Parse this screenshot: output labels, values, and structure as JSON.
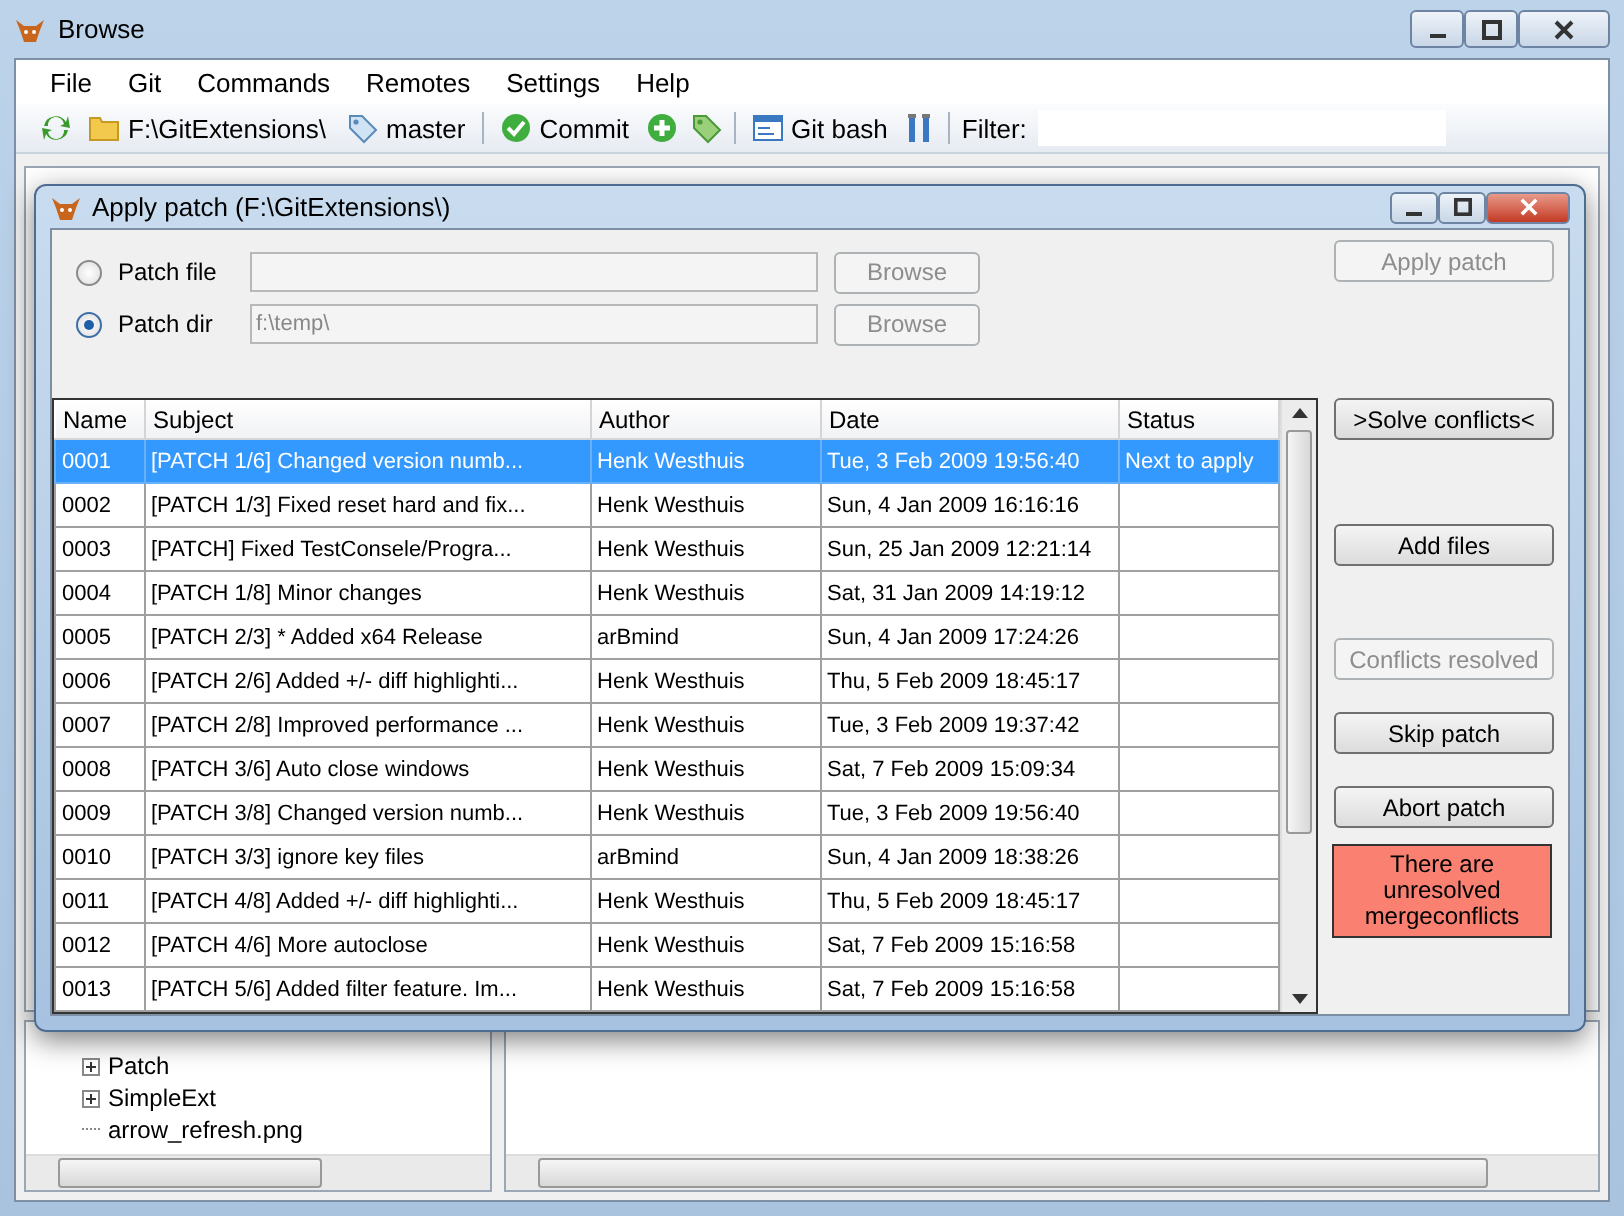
{
  "window": {
    "title": "Browse"
  },
  "menu": [
    "File",
    "Git",
    "Commands",
    "Remotes",
    "Settings",
    "Help"
  ],
  "toolbar": {
    "path": "F:\\GitExtensions\\",
    "branch": "master",
    "commit": "Commit",
    "git_bash": "Git bash",
    "filter_label": "Filter:"
  },
  "tree": {
    "items": [
      {
        "label": "Patch",
        "expandable": true
      },
      {
        "label": "SimpleExt",
        "expandable": true
      },
      {
        "label": "arrow_refresh.png",
        "expandable": false
      }
    ]
  },
  "dialog": {
    "title": "Apply patch (F:\\GitExtensions\\)",
    "sources": [
      {
        "label": "Patch file",
        "selected": false,
        "button": "Browse"
      },
      {
        "label": "Patch dir",
        "selected": true,
        "value": "f:\\temp\\",
        "button": "Browse"
      }
    ],
    "apply_button": {
      "label": "Apply patch",
      "disabled": true
    },
    "table": {
      "columns": [
        "Name",
        "Subject",
        "Author",
        "Date",
        "Status"
      ],
      "rows": [
        {
          "selected": true,
          "cells": [
            "0001",
            "[PATCH 1/6] Changed version numb...",
            "Henk Westhuis",
            "Tue, 3 Feb 2009 19:56:40",
            "Next to apply"
          ]
        },
        {
          "selected": false,
          "cells": [
            "0002",
            "[PATCH 1/3] Fixed reset hard and fix...",
            "Henk Westhuis",
            "Sun, 4 Jan 2009 16:16:16",
            ""
          ]
        },
        {
          "selected": false,
          "cells": [
            "0003",
            "[PATCH] Fixed TestConsele/Progra...",
            "Henk Westhuis",
            "Sun, 25 Jan 2009 12:21:14",
            ""
          ]
        },
        {
          "selected": false,
          "cells": [
            "0004",
            "[PATCH 1/8] Minor changes",
            "Henk Westhuis",
            "Sat, 31 Jan 2009 14:19:12",
            ""
          ]
        },
        {
          "selected": false,
          "cells": [
            "0005",
            "[PATCH 2/3]  * Added x64 Release",
            "arBmind",
            "Sun, 4 Jan 2009 17:24:26",
            ""
          ]
        },
        {
          "selected": false,
          "cells": [
            "0006",
            "[PATCH 2/6] Added +/- diff highlighti...",
            "Henk Westhuis",
            "Thu, 5 Feb 2009 18:45:17",
            ""
          ]
        },
        {
          "selected": false,
          "cells": [
            "0007",
            "[PATCH 2/8] Improved performance ...",
            "Henk Westhuis",
            "Tue, 3 Feb 2009 19:37:42",
            ""
          ]
        },
        {
          "selected": false,
          "cells": [
            "0008",
            "[PATCH 3/6] Auto close windows",
            "Henk Westhuis",
            "Sat, 7 Feb 2009 15:09:34",
            ""
          ]
        },
        {
          "selected": false,
          "cells": [
            "0009",
            "[PATCH 3/8] Changed version numb...",
            "Henk Westhuis",
            "Tue, 3 Feb 2009 19:56:40",
            ""
          ]
        },
        {
          "selected": false,
          "cells": [
            "0010",
            "[PATCH 3/3] ignore key files",
            "arBmind",
            "Sun, 4 Jan 2009 18:38:26",
            ""
          ]
        },
        {
          "selected": false,
          "cells": [
            "0011",
            "[PATCH 4/8] Added +/- diff highlighti...",
            "Henk Westhuis",
            "Thu, 5 Feb 2009 18:45:17",
            ""
          ]
        },
        {
          "selected": false,
          "cells": [
            "0012",
            "[PATCH 4/6] More autoclose",
            "Henk Westhuis",
            "Sat, 7 Feb 2009 15:16:58",
            ""
          ]
        },
        {
          "selected": false,
          "cells": [
            "0013",
            "[PATCH 5/6] Added filter feature. Im...",
            "Henk Westhuis",
            "Sat, 7 Feb 2009 15:16:58",
            ""
          ]
        }
      ]
    },
    "actions": [
      {
        "label": ">Solve conflicts<",
        "disabled": false
      },
      {
        "label": "Add files",
        "disabled": false
      },
      {
        "label": "Conflicts resolved",
        "disabled": true
      },
      {
        "label": "Skip patch",
        "disabled": false
      },
      {
        "label": "Abort patch",
        "disabled": false
      }
    ],
    "alert": "There are unresolved mergeconflicts"
  }
}
